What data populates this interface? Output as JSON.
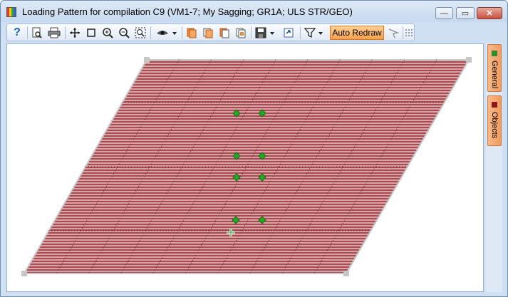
{
  "window": {
    "title": "Loading Pattern for compilation C9 (VM1-7; My Sagging; GR1A; ULS STR/GEO)",
    "controls": {
      "minimize": "—",
      "maximize": "▭",
      "close": "✕"
    }
  },
  "toolbar": {
    "help_label": "?",
    "auto_redraw_label": "Auto Redraw",
    "buttons": [
      "help-icon",
      "print-preview-icon",
      "print-icon",
      "pan-icon",
      "select-rectangle-icon",
      "zoom-in-icon",
      "zoom-out-icon",
      "zoom-extents-icon",
      "view-eye-icon",
      "copy-icon",
      "copy-alt-icon",
      "paste-icon",
      "paste-alt-icon",
      "save-icon",
      "refresh-icon",
      "filter-icon",
      "auto-redraw-button",
      "pointer-icon",
      "grid-icon"
    ]
  },
  "side_tabs": [
    {
      "label": "General",
      "color": "#2e8b2e"
    },
    {
      "label": "Objects",
      "color": "#8b1a1a"
    }
  ],
  "canvas": {
    "slab_fill": "#c98a8a",
    "hatch_color": "#7a0f1a",
    "load_point_color": "#22aa22",
    "load_point_count": 8
  }
}
